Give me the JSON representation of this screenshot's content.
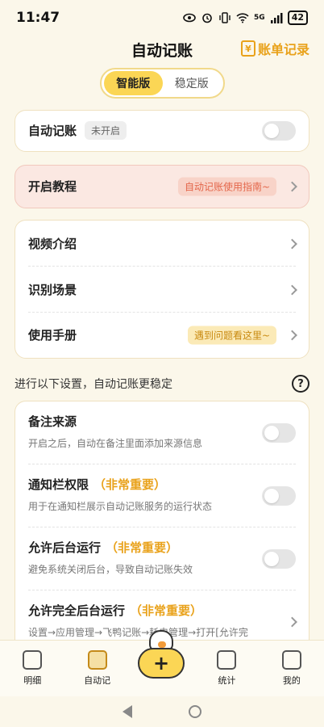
{
  "status_bar": {
    "time": "11:47",
    "battery": "42",
    "network": "5G"
  },
  "header": {
    "title": "自动记账",
    "bills_link": "账单记录",
    "bills_icon": "¥"
  },
  "version_switch": {
    "tabs": [
      {
        "label": "智能版",
        "active": true
      },
      {
        "label": "稳定版",
        "active": false
      }
    ]
  },
  "auto_bookkeeping": {
    "label": "自动记账",
    "status": "未开启"
  },
  "tutorial": {
    "label": "开启教程",
    "tag": "自动记账使用指南~"
  },
  "links": [
    {
      "label": "视频介绍"
    },
    {
      "label": "识别场景"
    },
    {
      "label": "使用手册",
      "tag": "遇到问题看这里~"
    }
  ],
  "settings_hint": {
    "text": "进行以下设置，自动记账更稳定",
    "help": "?"
  },
  "settings": [
    {
      "title": "备注来源",
      "importance": "",
      "desc": "开启之后，自动在备注里面添加来源信息",
      "has_toggle": true
    },
    {
      "title": "通知栏权限",
      "importance": "（非常重要）",
      "desc": "用于在通知栏展示自动记账服务的运行状态",
      "has_toggle": true
    },
    {
      "title": "允许后台运行",
      "importance": "（非常重要）",
      "desc": "避免系统关闭后台，导致自动记账失效",
      "has_toggle": true
    },
    {
      "title": "允许完全后台运行",
      "importance": "（非常重要）",
      "desc": "设置→应用管理→飞鸭记账→耗电管理→打开[允许完",
      "has_toggle": false
    }
  ],
  "bottom_nav": {
    "items": [
      {
        "label": "明细"
      },
      {
        "label": "自动记"
      },
      {
        "label": "统计"
      },
      {
        "label": "我的"
      }
    ],
    "add_label": "+"
  }
}
